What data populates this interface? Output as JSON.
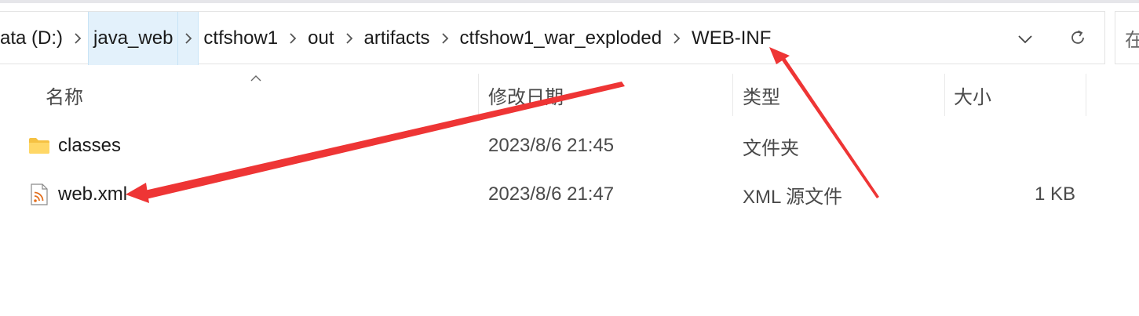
{
  "breadcrumb": {
    "items": [
      "ata (D:)",
      "java_web",
      "ctfshow1",
      "out",
      "artifacts",
      "ctfshow1_war_exploded",
      "WEB-INF"
    ],
    "separator_icon": "chevron-right-icon"
  },
  "toolbar": {
    "dropdown_icon": "chevron-down-icon",
    "refresh_icon": "refresh-icon",
    "search_text": "在"
  },
  "columns": {
    "name": "名称",
    "modified": "修改日期",
    "type": "类型",
    "size": "大小",
    "sort_icon": "sort-up-icon"
  },
  "files": [
    {
      "name": "classes",
      "modified": "2023/8/6 21:45",
      "type": "文件夹",
      "size": "",
      "icon": "folder-icon"
    },
    {
      "name": "web.xml",
      "modified": "2023/8/6 21:47",
      "type": "XML 源文件",
      "size": "1 KB",
      "icon": "xml-file-icon"
    }
  ],
  "colors": {
    "accent": "#e3f1fb",
    "arrow": "#ee3535",
    "folder": "#f7c948"
  }
}
